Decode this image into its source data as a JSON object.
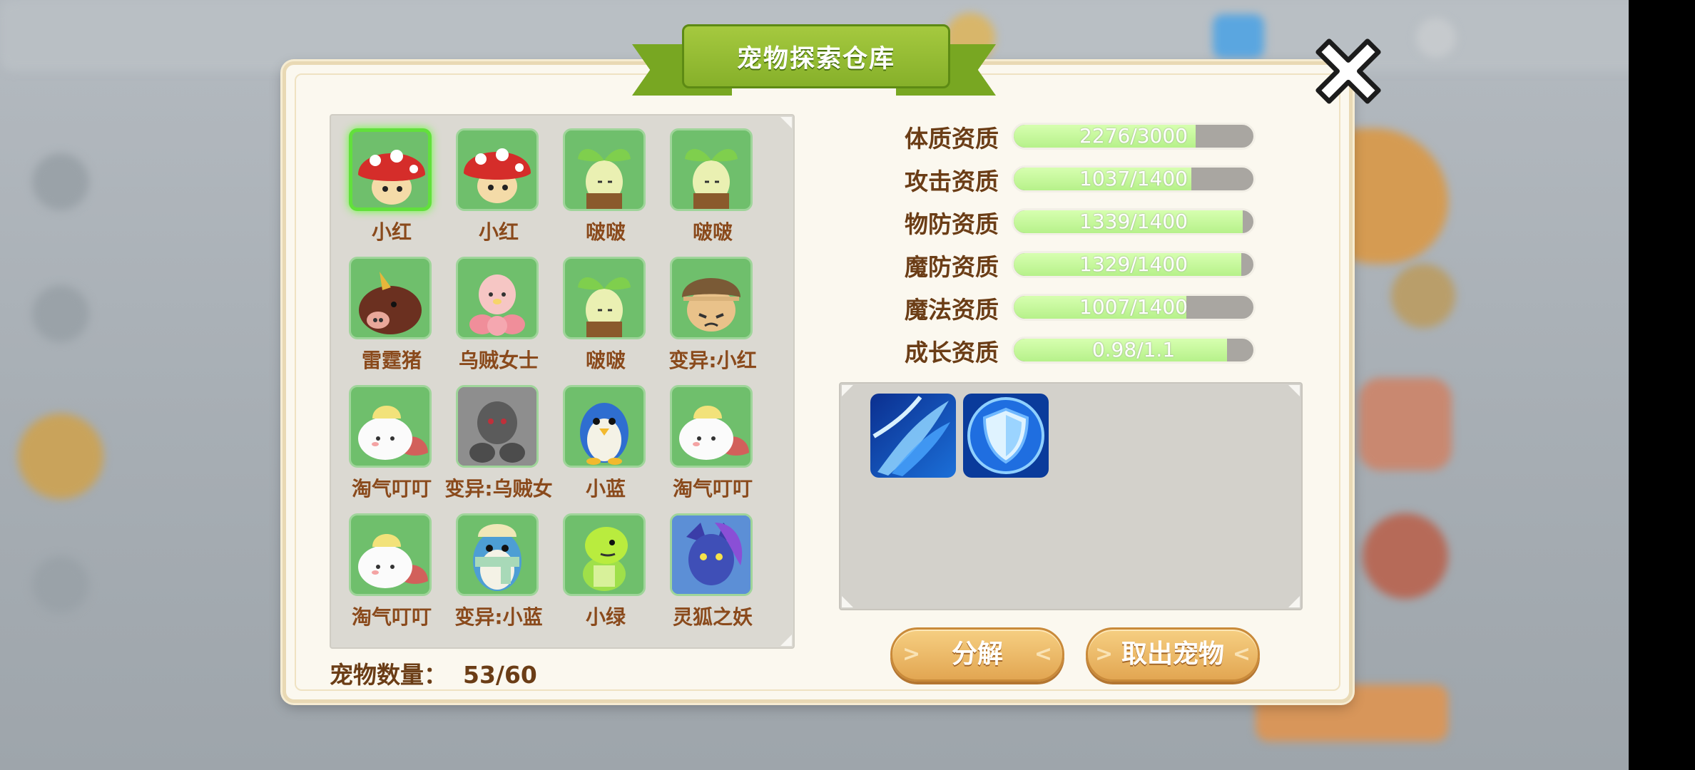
{
  "window": {
    "title": "宠物探索仓库"
  },
  "pets": [
    {
      "name": "小红",
      "icon": "red-mushroom",
      "selected": true
    },
    {
      "name": "小红",
      "icon": "red-mushroom",
      "selected": false
    },
    {
      "name": "啵啵",
      "icon": "sprout",
      "selected": false
    },
    {
      "name": "啵啵",
      "icon": "sprout",
      "selected": false
    },
    {
      "name": "雷霆猪",
      "icon": "boar",
      "selected": false
    },
    {
      "name": "乌贼女士",
      "icon": "pink-squid",
      "selected": false
    },
    {
      "name": "啵啵",
      "icon": "sprout",
      "selected": false
    },
    {
      "name": "变异:小红",
      "icon": "brown-mushroom",
      "selected": false
    },
    {
      "name": "淘气叮叮",
      "icon": "white-chick",
      "selected": false
    },
    {
      "name": "变异:乌贼女",
      "icon": "gray-squid",
      "selected": false
    },
    {
      "name": "小蓝",
      "icon": "blue-penguin",
      "selected": false
    },
    {
      "name": "淘气叮叮",
      "icon": "white-chick",
      "selected": false
    },
    {
      "name": "淘气叮叮",
      "icon": "white-chick",
      "selected": false
    },
    {
      "name": "变异:小蓝",
      "icon": "scarf-penguin",
      "selected": false
    },
    {
      "name": "小绿",
      "icon": "green-dino",
      "selected": false
    },
    {
      "name": "灵狐之妖",
      "icon": "fox-spirit",
      "selected": false
    }
  ],
  "pet_count": {
    "label": "宠物数量：",
    "value": "53/60"
  },
  "stats": [
    {
      "label": "体质资质",
      "value": "2276/3000",
      "fraction": 0.7587
    },
    {
      "label": "攻击资质",
      "value": "1037/1400",
      "fraction": 0.7407
    },
    {
      "label": "物防资质",
      "value": "1339/1400",
      "fraction": 0.9564
    },
    {
      "label": "魔防资质",
      "value": "1329/1400",
      "fraction": 0.9493
    },
    {
      "label": "魔法资质",
      "value": "1007/1400",
      "fraction": 0.7193
    },
    {
      "label": "成长资质",
      "value": "0.98/1.1",
      "fraction": 0.8909
    }
  ],
  "skills": [
    {
      "icon": "blue-slash-skill-icon"
    },
    {
      "icon": "blue-shield-skill-icon"
    }
  ],
  "buttons": {
    "decompose": "分解",
    "withdraw": "取出宠物"
  },
  "colors": {
    "bar_fill": "#c2f79a",
    "accent_green": "#86b02a",
    "button": "#e8b463"
  }
}
